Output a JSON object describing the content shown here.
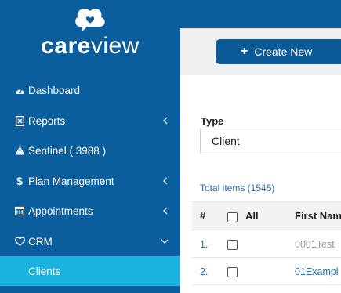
{
  "brand": {
    "logo_bold": "care",
    "logo_light": "view"
  },
  "sidebar": {
    "items": [
      {
        "label": "Dashboard",
        "icon": "dashboard-icon",
        "chevron": ""
      },
      {
        "label": "Reports",
        "icon": "file-icon",
        "chevron": "left"
      },
      {
        "label": "Sentinel ( 3988 )",
        "icon": "warning-icon",
        "chevron": ""
      },
      {
        "label": "Plan Management",
        "icon": "dollar-icon",
        "chevron": "left"
      },
      {
        "label": "Appointments",
        "icon": "calendar-icon",
        "chevron": "left"
      },
      {
        "label": "CRM",
        "icon": "heart-icon",
        "chevron": "down"
      },
      {
        "label": "Clients",
        "icon": "",
        "chevron": "",
        "active": true
      }
    ]
  },
  "toolbar": {
    "create_label": "Create New",
    "create_icon": "plus-icon"
  },
  "filter": {
    "type_label": "Type",
    "type_value": "Client"
  },
  "table": {
    "total_items": "Total items (1545)",
    "headers": {
      "num": "#",
      "all": "All",
      "first_name": "First Nam"
    },
    "rows": [
      {
        "num": "1.",
        "first_name": "0001Test",
        "muted": true
      },
      {
        "num": "2.",
        "first_name": "01Exampl",
        "muted": false
      }
    ]
  },
  "colors": {
    "sidebar_bg": "#0a5e9e",
    "active_item": "#1ab3e0",
    "button": "#0b5a98",
    "link": "#2c6fae"
  }
}
